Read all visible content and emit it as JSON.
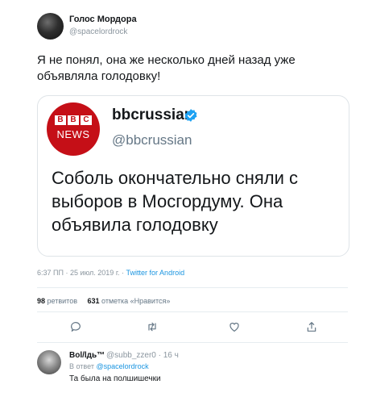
{
  "tweet": {
    "author_name": "Голос Мордора",
    "author_handle": "@spacelordrock",
    "text": "Я не понял, она же несколько дней назад уже объявляла голодовку!",
    "quoted": {
      "logo_letters": [
        "B",
        "B",
        "C"
      ],
      "logo_word": "NEWS",
      "name": "bbcrussian",
      "handle": "@bbcrussian",
      "text": "Соболь окончательно сняли с выборов в Мосгордуму. Она объявила голодовку"
    },
    "timestamp": "6:37 ПП · 25 июл. 2019 г.",
    "separator": "·",
    "source_app": "Twitter for Android",
    "retweets_count": "98",
    "retweets_label": "ретвитов",
    "likes_count": "631",
    "likes_label": "отметка «Нравится»"
  },
  "icons": {
    "reply": "reply-icon",
    "retweet": "retweet-icon",
    "like": "heart-icon",
    "share": "share-icon",
    "verified": "verified-badge-icon"
  },
  "reply": {
    "author_name": "Bol/lдь™",
    "author_handle": "@subb_zzer0 · 16 ч",
    "in_reply_prefix": "В ответ",
    "in_reply_to": "@spacelordrock",
    "text": "Та была на полшишечки"
  },
  "colors": {
    "accent": "#1b95e0",
    "bbc_red": "#c50f17",
    "muted": "#8a959e"
  }
}
